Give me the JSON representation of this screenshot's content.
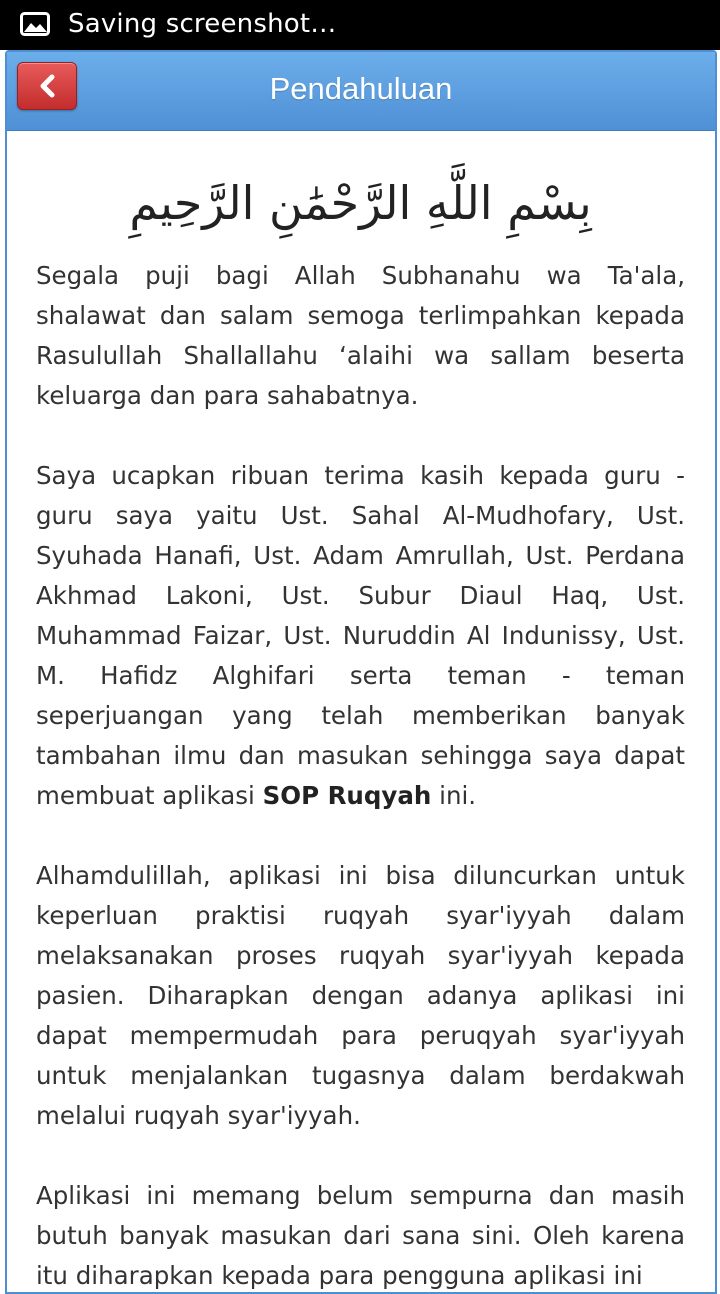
{
  "status_bar": {
    "text": "Saving screenshot…",
    "icon": "image-icon"
  },
  "header": {
    "title": "Pendahuluan",
    "back_icon": "chevron-left-icon",
    "colors": {
      "bar": "#5a9ee0",
      "back_button": "#d63c3c"
    }
  },
  "content": {
    "bismillah": "بِسْمِ اللَّهِ الرَّحْمَٰنِ الرَّحِيمِ",
    "paragraphs": [
      "Segala puji bagi Allah Subhanahu wa Ta'ala, shalawat dan salam semoga terlimpahkan kepada Rasulullah Shallallahu ‘alaihi wa sallam beserta keluarga dan para sahabatnya.",
      {
        "before": "Saya ucapkan ribuan terima kasih kepada guru - guru saya yaitu Ust. Sahal Al-Mudhofary, Ust. Syuhada Hanafi, Ust. Adam Amrullah, Ust. Perdana Akhmad Lakoni, Ust. Subur Diaul Haq, Ust. Muhammad Faizar, Ust. Nuruddin Al Indunissy, Ust. M. Hafidz Alghifari serta teman - teman seperjuangan yang telah memberikan banyak tambahan ilmu dan masukan sehingga saya dapat membuat aplikasi ",
        "bold": "SOP Ruqyah",
        "after": " ini."
      },
      "Alhamdulillah, aplikasi ini bisa diluncurkan untuk keperluan praktisi ruqyah syar'iyyah dalam melaksanakan proses ruqyah syar'iyyah kepada pasien. Diharapkan dengan adanya aplikasi ini dapat mempermudah para peruqyah syar'iyyah untuk menjalankan tugasnya dalam berdakwah melalui ruqyah syar'iyyah.",
      "Aplikasi ini memang belum sempurna dan masih butuh banyak masukan dari sana sini. Oleh karena itu diharapkan kepada para pengguna aplikasi ini"
    ]
  }
}
